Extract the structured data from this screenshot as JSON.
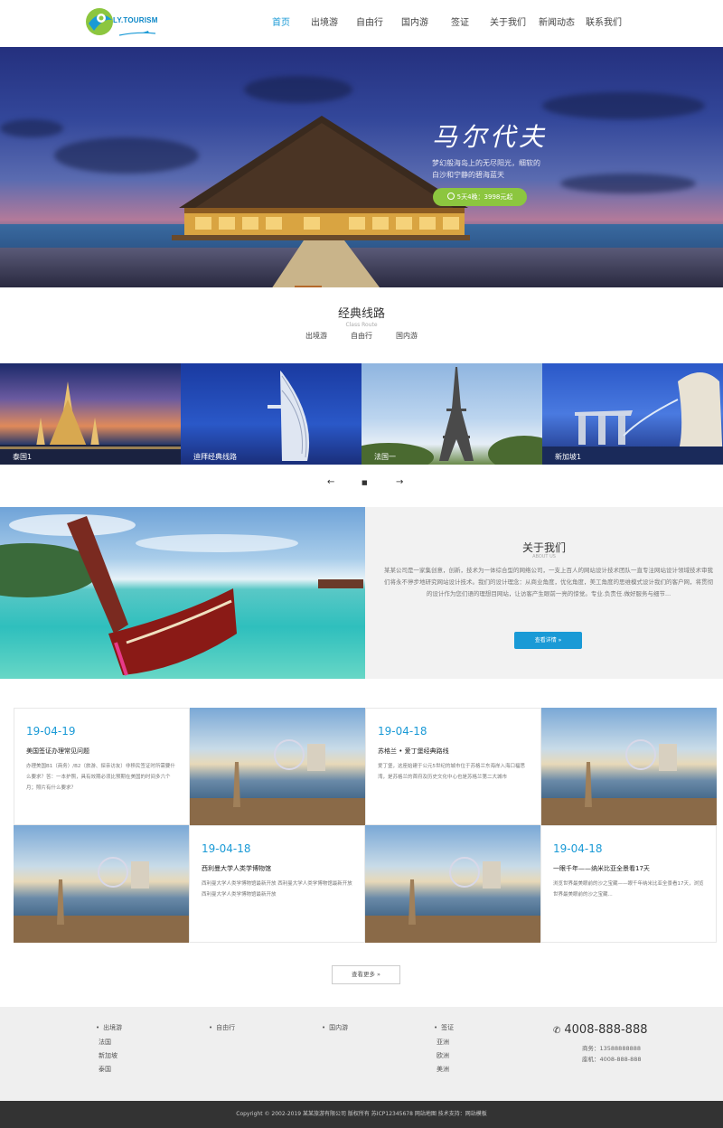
{
  "header": {
    "logo_text": "LY.TOURISM",
    "nav": [
      "首页",
      "出境游",
      "自由行",
      "国内游",
      "签证",
      "关于我们",
      "新闻动态",
      "联系我们"
    ],
    "active_index": 0
  },
  "hero": {
    "title": "马尔代夫",
    "subtitle_line1": "梦幻般海岛上的无尽阳光，细软的",
    "subtitle_line2": "白沙和宁静的碧海蓝天",
    "button": "5天4晚：3998元起"
  },
  "routes": {
    "title": "经典线路",
    "subtitle": "Class Route",
    "tabs": [
      "出境游",
      "自由行",
      "国内游"
    ],
    "items": [
      {
        "caption": "泰国1"
      },
      {
        "caption": "迪拜经典线路"
      },
      {
        "caption": "法国一"
      },
      {
        "caption": "新加坡1"
      }
    ],
    "prev": "←",
    "grid": "■",
    "next": "→"
  },
  "about": {
    "title": "关于我们",
    "subtitle": "ABOUT US",
    "text": "某某公司是一家集创意，创新，技术为一体综合型的网络公司，一支上百人的网站设计技术团队一直专注网站设计领域技术审我们将永不停步地研究网站设计技术。我们的设计理念：从商业角度，优化角度，美工角度的思维模式设计我们的客户网，将贯彻的设计作为您们语的理想目网站，让访客产生眼前一亮的惊觉。专业.负责任.做好服务与细节...",
    "button": "查看详情 »"
  },
  "news": [
    {
      "date": "19-04-19",
      "title": "美国签证办理常见问题",
      "desc": "办理美国B1（商务）/B2（旅游、探亲访友）非移民签证时所需要什么要求？答：一本护照，具有效期必须比预期在美国的时间多六个月；照片有什么要求？"
    },
    {
      "date": "19-04-18",
      "title": "苏格兰 • 爱丁堡经典路线",
      "desc": "爱丁堡，这座始建于公元5世纪的城市位于苏格兰东海岸入海口福思湾，是苏格兰的首府及历史文化中心也是苏格兰第二大城市"
    },
    {
      "date": "19-04-18",
      "title": "西利曼大学人类学博物馆",
      "desc": "西利曼大学人类学博物馆最新开放 西利曼大学人类学博物馆最新开放 西利曼大学人类学博物馆最新开放"
    },
    {
      "date": "19-04-18",
      "title": "一眼千年——纳米比亚全景看17天",
      "desc": "浏览世界最美眼前的沙之宝藏——眼千年纳米比亚全景看17天，浏览世界最美眼前的沙之宝藏..."
    }
  ],
  "more_button": "查看更多 »",
  "footer": {
    "columns": [
      {
        "head": "出境游",
        "items": [
          "法国",
          "新加坡",
          "泰国"
        ]
      },
      {
        "head": "自由行",
        "items": []
      },
      {
        "head": "国内游",
        "items": []
      },
      {
        "head": "签证",
        "items": [
          "亚洲",
          "欧洲",
          "美洲"
        ]
      }
    ],
    "phone": "4008-888-888",
    "phone_icon": "phone-icon",
    "contact1": "商务：13588888888",
    "contact2": "座机：4008-888-888",
    "copyright": "Copyright © 2002-2019 某某旅游有限公司 版权所有   苏ICP12345678   网站地图   技术支持：网站模板"
  },
  "colors": {
    "accent": "#1a9ad6",
    "hero_button": "#8cc63f"
  }
}
